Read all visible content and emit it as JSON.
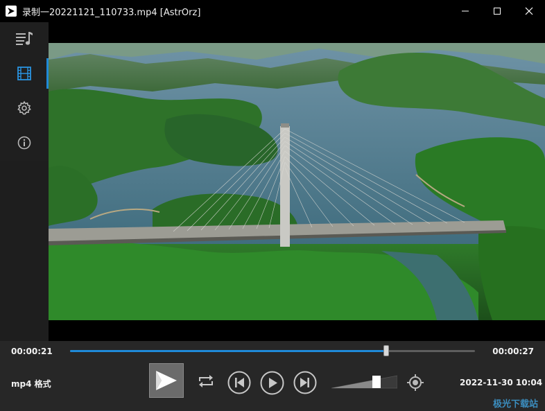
{
  "window": {
    "title": "录制一20221121_110733.mp4 [AstrOrz]"
  },
  "sidebar": {
    "items": [
      {
        "icon": "playlist-icon",
        "active": false
      },
      {
        "icon": "film-icon",
        "active": true
      },
      {
        "icon": "gear-icon",
        "active": false
      },
      {
        "icon": "info-icon",
        "active": false
      }
    ]
  },
  "player": {
    "current_time": "00:00:21",
    "total_time": "00:00:27",
    "progress_fraction": 0.78,
    "format_label": "mp4 格式",
    "volume_fraction": 0.75,
    "datetime": "2022-11-30 10:04"
  },
  "watermark": "极光下载站",
  "colors": {
    "accent": "#1f8ad8",
    "titlebar_bg": "#000000",
    "controls_bg": "#272727"
  }
}
